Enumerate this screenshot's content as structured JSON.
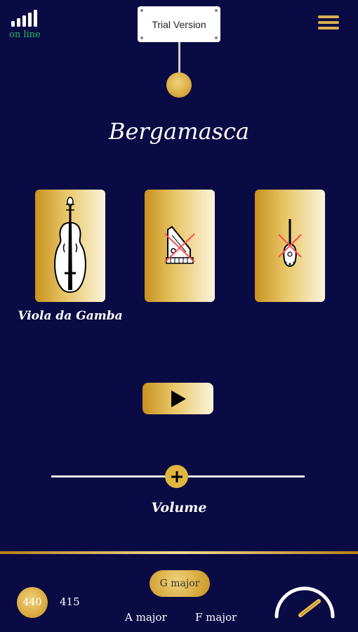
{
  "status": {
    "connection": "on line",
    "signal_icon": "signal-bars-icon"
  },
  "header": {
    "trial_label": "Trial Version",
    "menu_icon": "hamburger-menu-icon"
  },
  "piece": {
    "title": "Bergamasca"
  },
  "instruments": [
    {
      "label": "Viola da Gamba",
      "icon": "viola-da-gamba-icon",
      "selected": true
    },
    {
      "label": "",
      "icon": "harpsichord-icon",
      "selected": false,
      "disabled": true
    },
    {
      "label": "",
      "icon": "lute-icon",
      "selected": false,
      "disabled": true
    }
  ],
  "controls": {
    "play_icon": "play-icon",
    "volume_label": "Volume",
    "volume_value": 0.5
  },
  "tuning": {
    "frequencies": [
      "440",
      "415"
    ],
    "selected_frequency": "440",
    "keys": [
      "G major",
      "A major",
      "F major"
    ],
    "selected_key": "G major"
  },
  "tempo": {
    "gauge_icon": "tempo-gauge-icon"
  },
  "colors": {
    "background": "#0a0a44",
    "gold": "#d9a93a",
    "online": "#22c55e"
  }
}
